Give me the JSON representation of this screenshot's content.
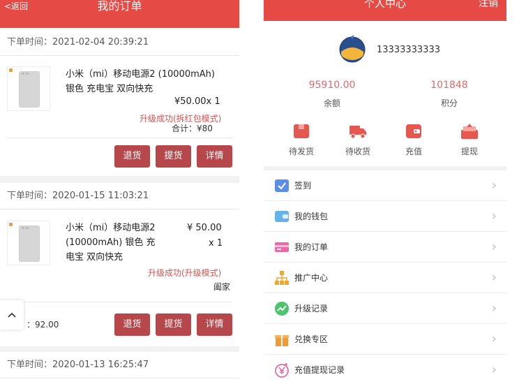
{
  "orders_page": {
    "back_label": "<返回",
    "title": "我的订单",
    "time_label": "下单时间：",
    "orders": [
      {
        "time": "2021-02-04 20:39:21",
        "name_line1": "小米（mi）移动电源2 (10000mAh)",
        "name_line2": "银色 充电宝 双向快充",
        "price": "¥50.00x 1",
        "status": "升级成功(拆红包模式)",
        "total": "合计：¥80",
        "buttons": [
          "退货",
          "提货",
          "详情"
        ]
      },
      {
        "time": "2020-01-15 11:03:21",
        "name_line1": "小米（mi）移动电源2",
        "name_line2": "(10000mAh) 银色 充",
        "name_line3": "电宝 双向快充",
        "price": "¥ 50.00",
        "qty": "x 1",
        "status": "升级成功(升级模式)",
        "extra": "阖家",
        "total": "：92.00",
        "buttons": [
          "退货",
          "提货",
          "详情"
        ]
      },
      {
        "time": "2020-01-13 16:25:47"
      }
    ],
    "scroll_top": "^"
  },
  "profile_page": {
    "title": "个人中心",
    "logout_label": "注销",
    "phone": "13333333333",
    "balance_value": "95910.00",
    "balance_label": "余额",
    "points_value": "101848",
    "points_label": "积分",
    "quick_actions": [
      {
        "label": "待发货",
        "icon": "box-icon",
        "color": "#e5584f"
      },
      {
        "label": "待收货",
        "icon": "truck-icon",
        "color": "#e5584f"
      },
      {
        "label": "充值",
        "icon": "wallet-icon",
        "color": "#e5584f"
      },
      {
        "label": "提现",
        "icon": "withdraw-icon",
        "color": "#e5584f"
      }
    ],
    "menu": [
      {
        "label": "签到",
        "icon": "checkin-icon",
        "color": "#5b8ee6"
      },
      {
        "label": "我的钱包",
        "icon": "wallet-icon",
        "color": "#66b3e8"
      },
      {
        "label": "我的订单",
        "icon": "order-card-icon",
        "color": "#e86aa6"
      },
      {
        "label": "推广中心",
        "icon": "hierarchy-icon",
        "color": "#f0a830"
      },
      {
        "label": "升级记录",
        "icon": "trend-icon",
        "color": "#4cc36e"
      },
      {
        "label": "兑换专区",
        "icon": "gift-icon",
        "color": "#f29a38"
      },
      {
        "label": "充值提现记录",
        "icon": "yen-icon",
        "color": "#e86aa6"
      }
    ],
    "chevron": "›",
    "accent": "#e54a44"
  }
}
